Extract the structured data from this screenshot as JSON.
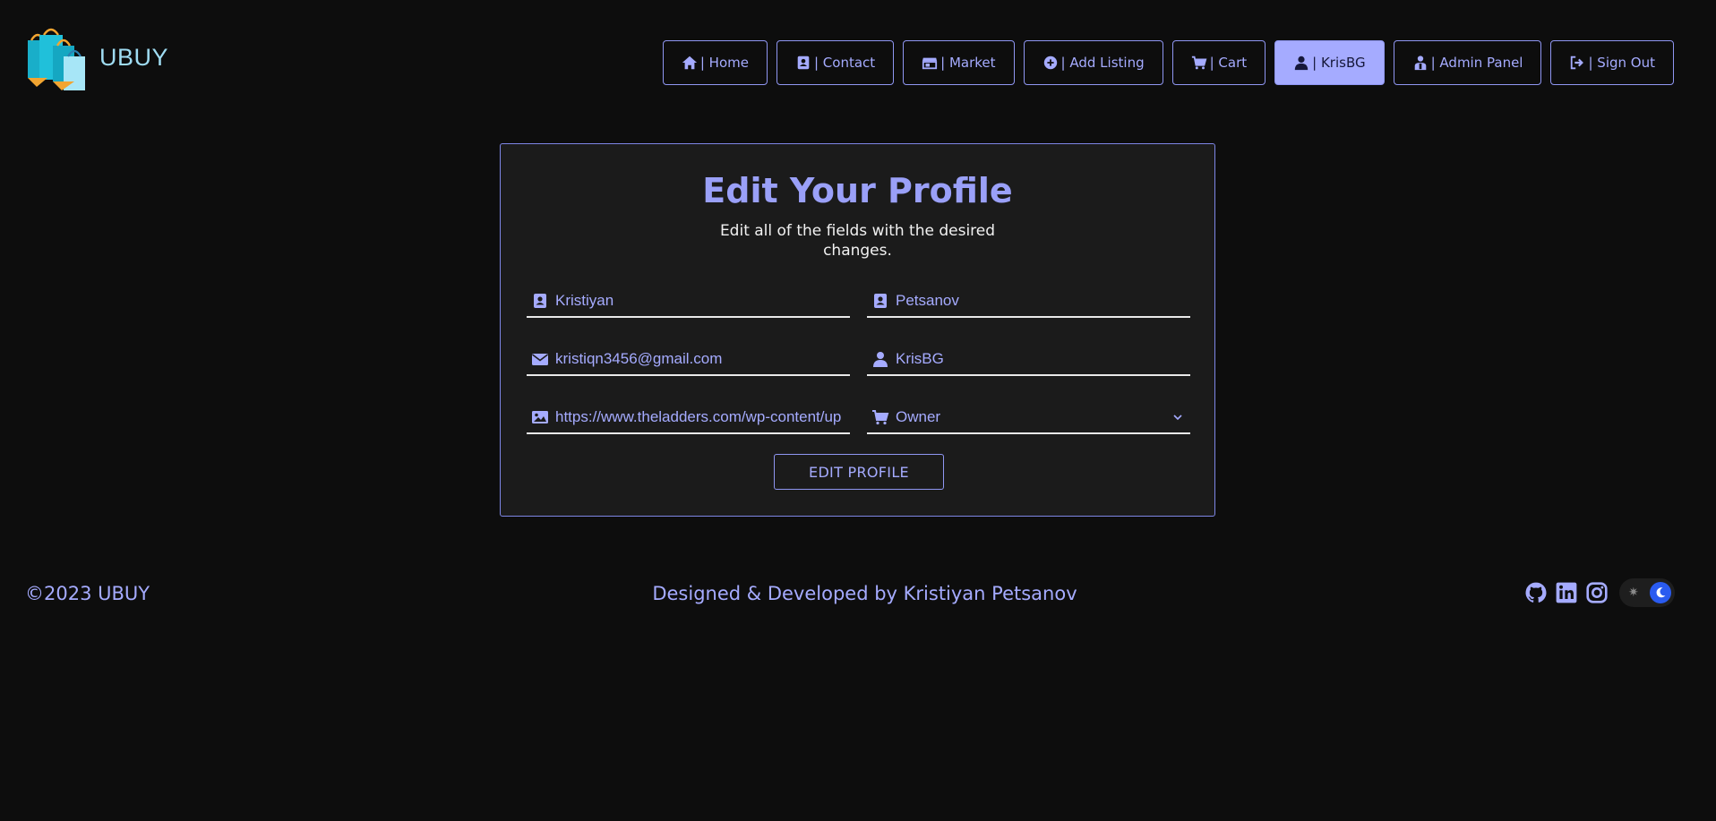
{
  "brand": {
    "name": "UBUY",
    "logo_icon": "shopping-bags-logo"
  },
  "nav": {
    "items": [
      {
        "label": "| Home",
        "icon": "home-icon"
      },
      {
        "label": "| Contact",
        "icon": "contact-card-icon"
      },
      {
        "label": "| Market",
        "icon": "store-icon"
      },
      {
        "label": "| Add Listing",
        "icon": "plus-circle-icon"
      },
      {
        "label": "| Cart",
        "icon": "cart-icon"
      },
      {
        "label": "| KrisBG",
        "icon": "user-icon",
        "active": true
      },
      {
        "label": "| Admin Panel",
        "icon": "admin-icon"
      },
      {
        "label": "| Sign Out",
        "icon": "sign-out-icon"
      }
    ]
  },
  "profile_form": {
    "title": "Edit Your Profile",
    "subtitle": "Edit all of the fields with the desired changes.",
    "first_name": "Kristiyan",
    "last_name": "Petsanov",
    "email": "kristiqn3456@gmail.com",
    "username": "KrisBG",
    "image_url": "https://www.theladders.com/wp-content/up",
    "role": "Owner",
    "submit_label": "EDIT PROFILE"
  },
  "footer": {
    "copyright": "©2023 UBUY",
    "credit": "Designed & Developed by Kristiyan Petsanov",
    "socials": [
      "github-icon",
      "linkedin-icon",
      "instagram-icon"
    ],
    "theme": "dark"
  },
  "colors": {
    "background": "#0d0d0d",
    "card": "#1b1b1b",
    "accent": "#a5abff",
    "toggle_accent": "#2a5bf0"
  }
}
